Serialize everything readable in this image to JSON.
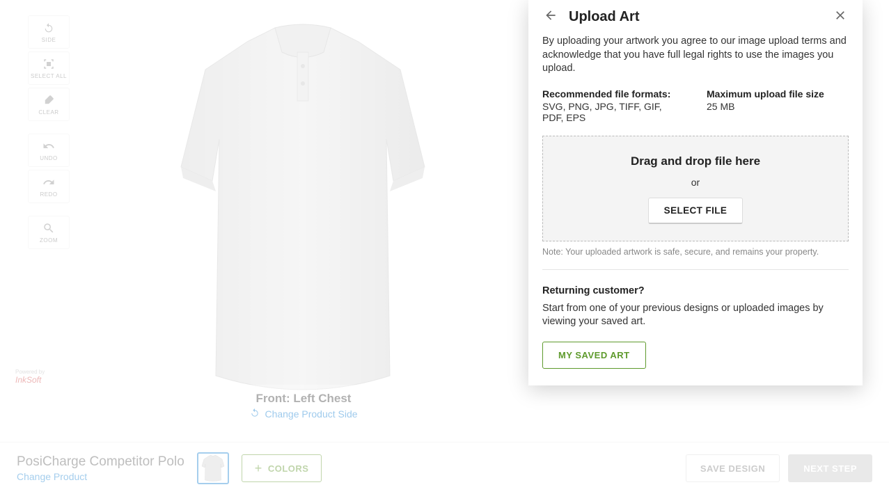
{
  "toolbar": {
    "side": "SIDE",
    "select_all": "SELECT ALL",
    "clear": "CLEAR",
    "undo": "UNDO",
    "redo": "REDO",
    "zoom": "ZOOM"
  },
  "product_side": {
    "label": "Front: Left Chest",
    "change": "Change Product Side"
  },
  "powered_by": {
    "prefix": "Powered by",
    "brand": "InkSoft"
  },
  "bottom": {
    "product_name": "PosiCharge Competitor Polo",
    "change_product": "Change Product",
    "colors": "COLORS",
    "save": "SAVE DESIGN",
    "next": "NEXT STEP"
  },
  "panel": {
    "title": "Upload Art",
    "terms": "By uploading your artwork you agree to our image upload terms and acknowledge that you have full legal rights to use the images you upload.",
    "formats_label": "Recommended file formats:",
    "formats_value": "SVG, PNG, JPG, TIFF, GIF, PDF, EPS",
    "size_label": "Maximum upload file size",
    "size_value": "25 MB",
    "dropzone_title": "Drag and drop file here",
    "dropzone_or": "or",
    "select_file": "SELECT FILE",
    "note": "Note: Your uploaded artwork is safe, secure, and remains your property.",
    "returning_title": "Returning customer?",
    "returning_body": "Start from one of your previous designs or uploaded images by viewing your saved art.",
    "saved_art": "MY SAVED ART"
  }
}
